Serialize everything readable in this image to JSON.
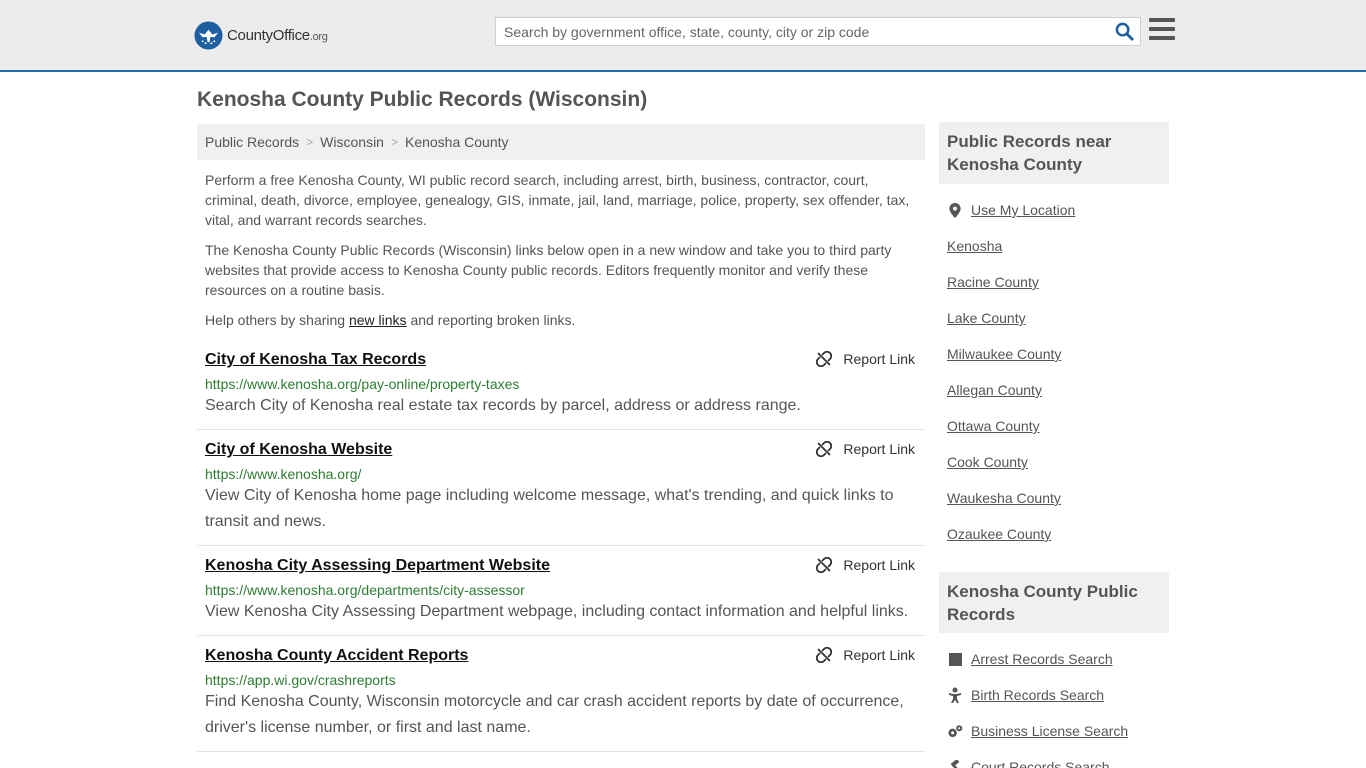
{
  "header": {
    "logo_main": "CountyOffice",
    "logo_suffix": ".org",
    "search_placeholder": "Search by government office, state, county, city or zip code"
  },
  "page": {
    "title": "Kenosha County Public Records (Wisconsin)"
  },
  "breadcrumb": [
    "Public Records",
    "Wisconsin",
    "Kenosha County"
  ],
  "intro": {
    "p1": "Perform a free Kenosha County, WI public record search, including arrest, birth, business, contractor, court, criminal, death, divorce, employee, genealogy, GIS, inmate, jail, land, marriage, police, property, sex offender, tax, vital, and warrant records searches.",
    "p2": "The Kenosha County Public Records (Wisconsin) links below open in a new window and take you to third party websites that provide access to Kenosha County public records. Editors frequently monitor and verify these resources on a routine basis.",
    "p3_before": "Help others by sharing ",
    "p3_link": "new links",
    "p3_after": " and reporting broken links."
  },
  "report_label": "Report Link",
  "records": [
    {
      "title": "City of Kenosha Tax Records",
      "url": "https://www.kenosha.org/pay-online/property-taxes",
      "desc": "Search City of Kenosha real estate tax records by parcel, address or address range."
    },
    {
      "title": "City of Kenosha Website",
      "url": "https://www.kenosha.org/",
      "desc": "View City of Kenosha home page including welcome message, what's trending, and quick links to transit and news."
    },
    {
      "title": "Kenosha City Assessing Department Website",
      "url": "https://www.kenosha.org/departments/city-assessor",
      "desc": "View Kenosha City Assessing Department webpage, including contact information and helpful links."
    },
    {
      "title": "Kenosha County Accident Reports",
      "url": "https://app.wi.gov/crashreports",
      "desc": "Find Kenosha County, Wisconsin motorcycle and car crash accident reports by date of occurrence, driver's license number, or first and last name."
    }
  ],
  "sidebar": {
    "nearby_title": "Public Records near Kenosha County",
    "use_location": "Use My Location",
    "nearby": [
      "Kenosha",
      "Racine County",
      "Lake County",
      "Milwaukee County",
      "Allegan County",
      "Ottawa County",
      "Cook County",
      "Waukesha County",
      "Ozaukee County"
    ],
    "county_title": "Kenosha County Public Records",
    "county_links": [
      {
        "label": "Arrest Records Search",
        "icon": "square-icon"
      },
      {
        "label": "Birth Records Search",
        "icon": "baby-icon"
      },
      {
        "label": "Business License Search",
        "icon": "gears-icon"
      },
      {
        "label": "Court Records Search",
        "icon": "gavel-icon"
      }
    ]
  },
  "colors": {
    "header_bg": "#ececec",
    "header_border": "#1d6fa8",
    "logo_blue": "#1d5fa0",
    "search_icon": "#1d5fa0",
    "url_green": "#2e7d32"
  }
}
